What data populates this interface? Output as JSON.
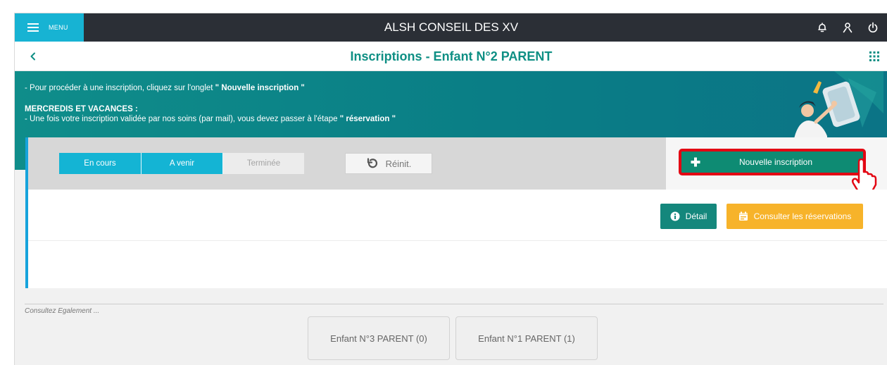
{
  "topbar": {
    "menu_label": "MENU",
    "app_title": "ALSH CONSEIL DES XV",
    "icons": [
      "bell-icon",
      "user-icon",
      "power-icon"
    ],
    "accent_color": "#17b3d3"
  },
  "subheader": {
    "title": "Inscriptions  -  Enfant N°2 PARENT",
    "title_color": "#0e8f84"
  },
  "banner": {
    "line1_prefix": "- Pour procéder à une inscription, cliquez sur l'onglet ",
    "line1_bold": "\" Nouvelle inscription \"",
    "line2": "MERCREDIS ET VACANCES :",
    "line3_prefix": "- Une fois votre inscription validée par nos soins (par mail), vous devez passer à l'étape ",
    "line3_bold": "\" réservation \"",
    "color": "#0a7e86"
  },
  "filters": {
    "tabs": [
      {
        "label": "En cours",
        "active": true
      },
      {
        "label": "A venir",
        "active": true
      },
      {
        "label": "Terminée",
        "active": false
      }
    ],
    "reset_label": "Réinit."
  },
  "new_inscription": {
    "label": "Nouvelle inscription",
    "color": "#0e8b73",
    "highlight_color": "#e30613"
  },
  "actions": {
    "detail_label": "Détail",
    "reservations_label": "Consulter les réservations",
    "reservations_color": "#f7b32a"
  },
  "footer": {
    "consult_label": "Consultez Egalement ...",
    "children": [
      "Enfant N°3 PARENT (0)",
      "Enfant N°1 PARENT (1)"
    ]
  }
}
